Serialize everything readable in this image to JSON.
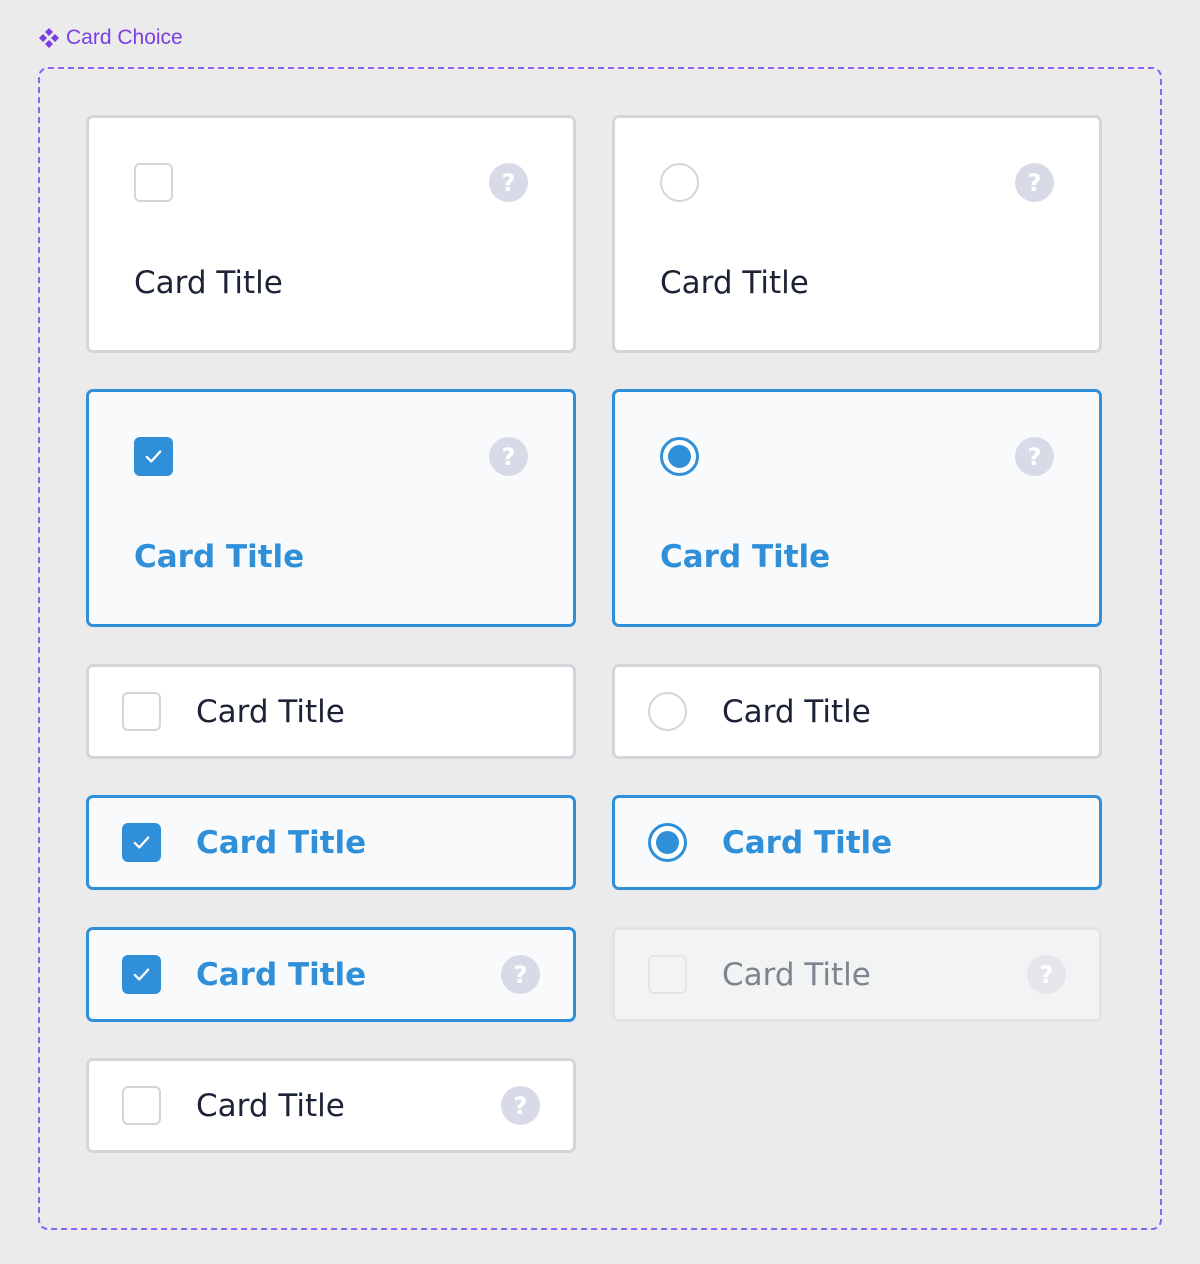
{
  "frame": {
    "label": "Card Choice",
    "icon": "component-icon",
    "accent": "#7b3fe4"
  },
  "colors": {
    "selected": "#2f8fd8",
    "border": "#d3d5db",
    "help_bg": "#d8dbe7"
  },
  "cards": [
    {
      "control": "checkbox",
      "state": "unchecked",
      "title": "Card Title",
      "help": "?"
    },
    {
      "control": "radio",
      "state": "unselected",
      "title": "Card Title",
      "help": "?"
    },
    {
      "control": "checkbox",
      "state": "checked",
      "title": "Card Title",
      "help": "?"
    },
    {
      "control": "radio",
      "state": "selected",
      "title": "Card Title",
      "help": "?"
    },
    {
      "control": "checkbox",
      "state": "unchecked",
      "title": "Card Title"
    },
    {
      "control": "radio",
      "state": "unselected",
      "title": "Card Title"
    },
    {
      "control": "checkbox",
      "state": "checked",
      "title": "Card Title"
    },
    {
      "control": "radio",
      "state": "selected",
      "title": "Card Title"
    },
    {
      "control": "checkbox",
      "state": "checked",
      "title": "Card Title",
      "help": "?"
    },
    {
      "control": "checkbox",
      "state": "disabled",
      "title": "Card Title",
      "help": "?"
    },
    {
      "control": "checkbox",
      "state": "unchecked",
      "title": "Card Title",
      "help": "?"
    }
  ]
}
